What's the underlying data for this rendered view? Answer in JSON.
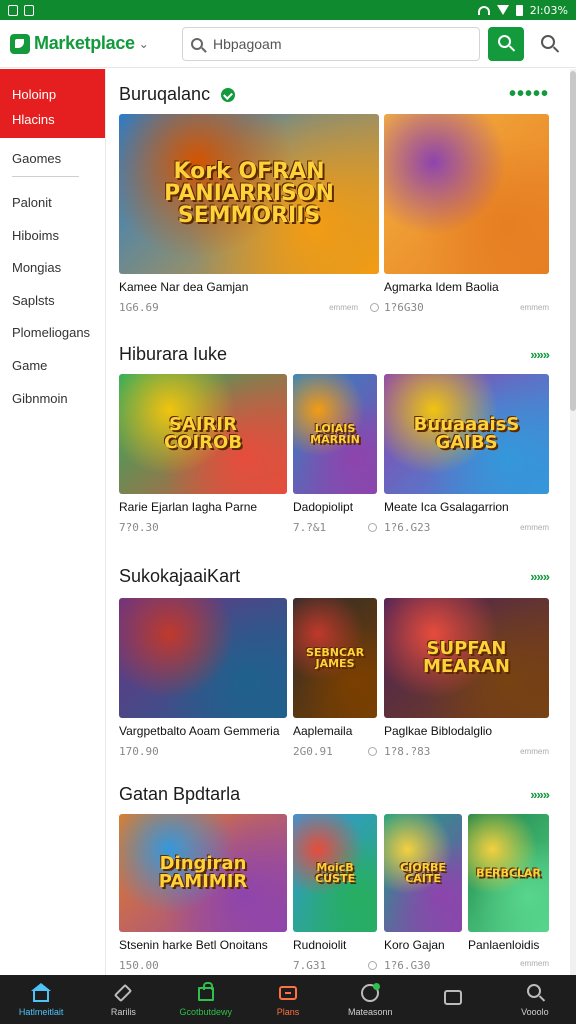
{
  "status_bar": {
    "time": "2l:03%"
  },
  "app_bar": {
    "brand": "Marketplace",
    "search_value": "Hbpagoam",
    "brand_color": "#129a3c"
  },
  "sidebar": {
    "active": [
      "Holoinp",
      "Hlacins"
    ],
    "items_top": "Gaomes",
    "items": [
      "Palonit",
      "Hiboims",
      "Mongias",
      "Saplsts",
      "Plomeliogans",
      "Game",
      "Gibnmoin"
    ],
    "accent": "#e51f1f"
  },
  "sections": [
    {
      "title": "Buruqalanc",
      "more": "•••••",
      "cards": [
        {
          "art": "Kork OFRAN\nPANIARRISON\nSEMMORIIS",
          "title": "Kamee Nar dea Gamjan",
          "price": "1G6.69",
          "sub": "emmem",
          "palette": [
            "#1e7fd8",
            "#f39c12",
            "#d35400"
          ]
        },
        {
          "art": "",
          "title": "Agmarka Idem Baolia",
          "price": "1?6G30",
          "sub": "emmem",
          "palette": [
            "#f5b041",
            "#e67e22",
            "#8e44ad"
          ]
        }
      ]
    },
    {
      "title": "Hiburara Iuke",
      "more": "»»»",
      "cards": [
        {
          "art": "SAIRIR\nCOIROB",
          "title": "Rarie Ejarlan Iagha Parne",
          "price": "7?0.30",
          "sub": "",
          "palette": [
            "#27ae60",
            "#e74c3c",
            "#f1c40f"
          ]
        },
        {
          "art": "LOIAIS\nMARRIN",
          "title": "Dadopiolipt",
          "price": "7.?&1",
          "sub": "",
          "palette": [
            "#2e86c1",
            "#8e44ad",
            "#f39c12"
          ]
        },
        {
          "art": "BuuaaaisS\nGAIBS",
          "title": "Meate Ica Gsalagarrion",
          "price": "1?6.G23",
          "sub": "emmem",
          "palette": [
            "#8e44ad",
            "#3498db",
            "#f1c40f"
          ]
        }
      ]
    },
    {
      "title": "SukokajaaiKart",
      "more": "»»»",
      "cards": [
        {
          "art": "",
          "title": "Vargpetbalto Aoam Gemmeria",
          "price": "170.90",
          "sub": "",
          "palette": [
            "#6c3483",
            "#1f618d",
            "#c0392b"
          ]
        },
        {
          "art": "SEBNCAR\nJAMES",
          "title": "Aaplemaila",
          "price": "2G0.91",
          "sub": "",
          "palette": [
            "#2c2c2c",
            "#7b3f00",
            "#c0392b"
          ]
        },
        {
          "art": "SUPFAN\nMEARAN",
          "title": "Paglkae Biblodalglio",
          "price": "1?8.?83",
          "sub": "emmem",
          "palette": [
            "#4a235a",
            "#784212",
            "#e74c3c"
          ]
        }
      ]
    },
    {
      "title": "Gatan Bpdtarla",
      "more": "»»»",
      "cards": [
        {
          "art": "Dingiran\nPAMIMIR",
          "title": "Stsenin harke Betl Onoitans",
          "price": "150.00",
          "sub": "",
          "palette": [
            "#e67e22",
            "#8e44ad",
            "#3498db"
          ]
        },
        {
          "art": "MoicB\nCUSTE",
          "title": "Rudnoiolit",
          "price": "7.G31",
          "sub": "",
          "palette": [
            "#3498db",
            "#27ae60",
            "#e74c3c"
          ]
        },
        {
          "art": "CIORBE\nCAITE",
          "title": "Koro Gajan",
          "price": "1?6.G30",
          "sub": "",
          "palette": [
            "#16a085",
            "#8e44ad",
            "#f4d03f"
          ]
        },
        {
          "art": "BERBCLAR",
          "title": "Panlaenloidis",
          "price": "",
          "sub": "emmem",
          "palette": [
            "#1e8449",
            "#58d68d",
            "#f4d03f"
          ]
        }
      ]
    }
  ],
  "bottom_nav": [
    {
      "label": "Hatlmeitlait",
      "icon": "home-icon"
    },
    {
      "label": "Rarilis",
      "icon": "tag-icon"
    },
    {
      "label": "Gcotbutdewy",
      "icon": "store-bag-icon"
    },
    {
      "label": "Plans",
      "icon": "play-icon"
    },
    {
      "label": "Mateasonn",
      "icon": "messages-icon"
    },
    {
      "label": "",
      "icon": "chat-icon"
    },
    {
      "label": "Vooolo",
      "icon": "search-icon"
    }
  ]
}
